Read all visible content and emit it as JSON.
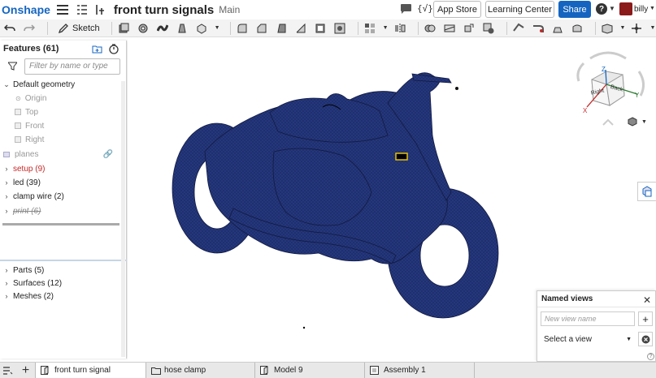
{
  "app": {
    "logo": "Onshape",
    "doc_title": "front turn signals",
    "branch": "Main"
  },
  "header": {
    "app_store": "App Store",
    "learning_center": "Learning Center",
    "share": "Share",
    "help": "?",
    "user": "billy"
  },
  "toolbar": {
    "sketch": "Sketch"
  },
  "features": {
    "title": "Features (61)",
    "filter_placeholder": "Filter by name or type",
    "default_geometry": "Default geometry",
    "origin": "Origin",
    "planes": [
      "Top",
      "Front",
      "Right"
    ],
    "items": [
      {
        "label": "planes"
      },
      {
        "label": "setup (9)"
      },
      {
        "label": "led (39)"
      },
      {
        "label": "clamp wire (2)"
      },
      {
        "label": "print (6)"
      }
    ],
    "parts": "Parts (5)",
    "surfaces": "Surfaces (12)",
    "meshes": "Meshes (2)"
  },
  "viewcube": {
    "face_right": "Right",
    "face_back": "Back",
    "axis_x": "X",
    "axis_y": "Y",
    "axis_z": "Z"
  },
  "named_views": {
    "title": "Named views",
    "placeholder": "New view name",
    "select": "Select a view"
  },
  "tabs": [
    {
      "label": "front turn signal"
    },
    {
      "label": "hose clamp"
    },
    {
      "label": "Model 9"
    },
    {
      "label": "Assembly 1"
    }
  ],
  "colors": {
    "accent": "#1565c0",
    "model": "#1f2f6e",
    "red_item": "#c62828"
  }
}
